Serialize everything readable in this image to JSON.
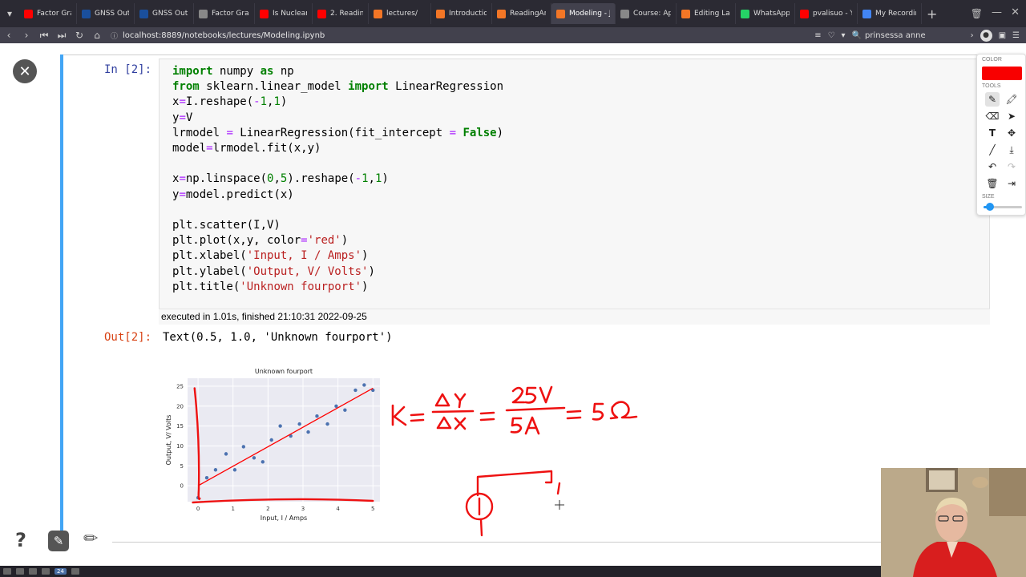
{
  "browser": {
    "tabs": [
      {
        "title": "Factor Graph",
        "color": "#ff0000"
      },
      {
        "title": "GNSS Outlier",
        "color": "#1a4f9c"
      },
      {
        "title": "GNSS Outlier",
        "color": "#1a4f9c"
      },
      {
        "title": "Factor Graph",
        "color": "#888888"
      },
      {
        "title": "Is Nuclear Po",
        "color": "#ff0000"
      },
      {
        "title": "2. Reading an",
        "color": "#ff0000"
      },
      {
        "title": "lectures/",
        "color": "#f37626"
      },
      {
        "title": "Introduction",
        "color": "#f37626"
      },
      {
        "title": "ReadingAndI",
        "color": "#f37626"
      },
      {
        "title": "Modeling - Ju",
        "color": "#f37626"
      },
      {
        "title": "Course: Appli",
        "color": "#888888"
      },
      {
        "title": "Editing Label",
        "color": "#f37626"
      },
      {
        "title": "WhatsApp",
        "color": "#25d366"
      },
      {
        "title": "pvalisuo - You",
        "color": "#ff0000"
      },
      {
        "title": "My Recording",
        "color": "#4285f4"
      }
    ],
    "active_tab_index": 9,
    "url": "localhost:8889/notebooks/lectures/Modeling.ipynb",
    "profile_name": "prinsessa anne"
  },
  "notebook": {
    "in_prompt": "In [2]:",
    "out_prompt": "Out[2]:",
    "execution_info": "executed in 1.01s, finished 21:10:31 2022-09-25",
    "output_text": "Text(0.5, 1.0, 'Unknown fourport')"
  },
  "annotation_toolbar": {
    "color_label": "COLOR",
    "tools_label": "TOOLS",
    "size_label": "SIZE",
    "color": "#f80000",
    "size": 0.1
  },
  "handwriting": {
    "formula": "K = ΔY/ΔX = 25V/5A = 5Ω"
  },
  "chart_data": {
    "type": "scatter",
    "title": "Unknown fourport",
    "xlabel": "Input, I / Amps",
    "ylabel": "Output, V/ Volts",
    "xlim": [
      -0.3,
      5.2
    ],
    "ylim": [
      -4,
      27
    ],
    "xticks": [
      0,
      1,
      2,
      3,
      4,
      5
    ],
    "yticks": [
      0,
      5,
      10,
      15,
      20,
      25
    ],
    "grid": true,
    "series": [
      {
        "kind": "scatter",
        "color": "#4c72b0",
        "x": [
          0.0,
          0.25,
          0.5,
          0.8,
          1.05,
          1.3,
          1.6,
          1.85,
          2.1,
          2.35,
          2.65,
          2.9,
          3.15,
          3.4,
          3.7,
          3.95,
          4.2,
          4.5,
          4.75,
          5.0
        ],
        "y": [
          -3.0,
          2.0,
          4.0,
          8.0,
          4.0,
          9.8,
          7.0,
          6.0,
          11.5,
          15.0,
          12.5,
          15.5,
          13.5,
          17.5,
          15.5,
          20.0,
          19.0,
          24.0,
          25.3,
          24.0
        ]
      },
      {
        "kind": "line",
        "color": "#ff0000",
        "x": [
          0,
          5
        ],
        "y": [
          0,
          24.5
        ]
      }
    ]
  }
}
